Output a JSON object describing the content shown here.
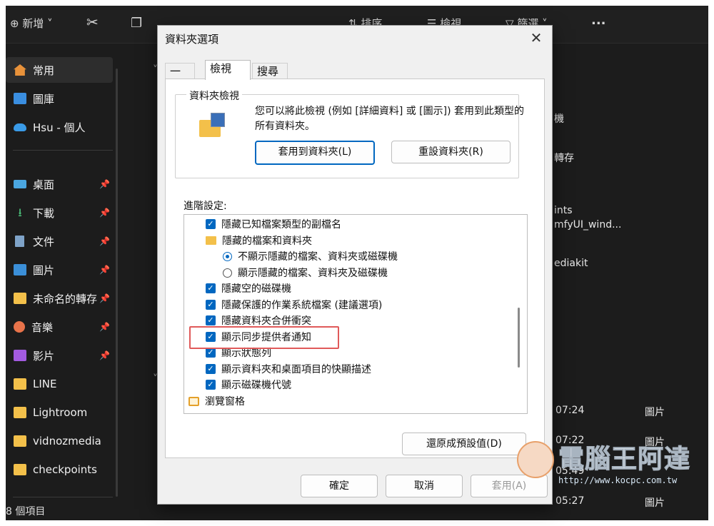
{
  "explorer": {
    "toolbar": {
      "new_label": "新增",
      "sort_label": "排序",
      "view_label": "檢視",
      "filter_label": "篩選",
      "more_label": "..."
    },
    "sidebar": [
      {
        "label": "常用",
        "icon": "home-icon",
        "pinned": false
      },
      {
        "label": "圖庫",
        "icon": "gallery-icon",
        "pinned": false
      },
      {
        "label": "Hsu - 個人",
        "icon": "cloud-icon",
        "pinned": false
      },
      {
        "label": "桌面",
        "icon": "desktop-icon",
        "pinned": true
      },
      {
        "label": "下載",
        "icon": "download-icon",
        "pinned": true
      },
      {
        "label": "文件",
        "icon": "document-icon",
        "pinned": true
      },
      {
        "label": "圖片",
        "icon": "picture-icon",
        "pinned": true
      },
      {
        "label": "未命名的轉存",
        "icon": "folder-icon",
        "pinned": true
      },
      {
        "label": "音樂",
        "icon": "music-icon",
        "pinned": true
      },
      {
        "label": "影片",
        "icon": "video-icon",
        "pinned": true
      },
      {
        "label": "LINE",
        "icon": "folder-icon",
        "pinned": false
      },
      {
        "label": "Lightroom",
        "icon": "folder-icon",
        "pinned": false
      },
      {
        "label": "vidnozmediakit",
        "icon": "folder-icon",
        "pinned": false
      },
      {
        "label": "checkpoints",
        "icon": "folder-icon",
        "pinned": false
      }
    ],
    "right_texts": [
      "機",
      "轉存",
      "ints",
      "mfyUI_wind...",
      "ediakit"
    ],
    "rows": [
      {
        "time": "07:24",
        "type": "圖片"
      },
      {
        "time": "07:22",
        "type": "圖片"
      },
      {
        "time": "05:49",
        "type": ""
      },
      {
        "time": "05:27",
        "type": "圖片"
      }
    ],
    "status": "8 個項目"
  },
  "dialog": {
    "title": "資料夾選項",
    "tabs": [
      "一般",
      "檢視",
      "搜尋"
    ],
    "group_title": "資料夾檢視",
    "description": "您可以將此檢視 (例如 [詳細資料] 或 [圖示]) 套用到此類型的所有資料夾。",
    "apply_to_folders": "套用到資料夾(L)",
    "reset_folders": "重設資料夾(R)",
    "advanced_label": "進階設定:",
    "settings": [
      {
        "kind": "checkbox",
        "label": "隱藏已知檔案類型的副檔名",
        "indent": 1,
        "checked": true
      },
      {
        "kind": "folder",
        "label": "隱藏的檔案和資料夾",
        "indent": 1
      },
      {
        "kind": "radio",
        "label": "不顯示隱藏的檔案、資料夾或磁碟機",
        "indent": 2,
        "checked": true
      },
      {
        "kind": "radio",
        "label": "顯示隱藏的檔案、資料夾及磁碟機",
        "indent": 2,
        "checked": false
      },
      {
        "kind": "checkbox",
        "label": "隱藏空的磁碟機",
        "indent": 1,
        "checked": true
      },
      {
        "kind": "checkbox",
        "label": "隱藏保護的作業系統檔案 (建議選項)",
        "indent": 1,
        "checked": true
      },
      {
        "kind": "checkbox",
        "label": "隱藏資料夾合併衝突",
        "indent": 1,
        "checked": true
      },
      {
        "kind": "checkbox",
        "label": "顯示同步提供者通知",
        "indent": 1,
        "checked": true
      },
      {
        "kind": "checkbox",
        "label": "顯示狀態列",
        "indent": 1,
        "checked": true
      },
      {
        "kind": "checkbox",
        "label": "顯示資料夾和桌面項目的快顯描述",
        "indent": 1,
        "checked": true
      },
      {
        "kind": "checkbox",
        "label": "顯示磁碟機代號",
        "indent": 1,
        "checked": true
      },
      {
        "kind": "tree",
        "label": "瀏覽窗格",
        "indent": 0
      }
    ],
    "restore_defaults": "還原成預設值(D)",
    "ok": "確定",
    "cancel": "取消",
    "apply": "套用(A)"
  },
  "watermark": {
    "text": "電腦王阿達",
    "url": "http://www.kocpc.com.tw"
  }
}
